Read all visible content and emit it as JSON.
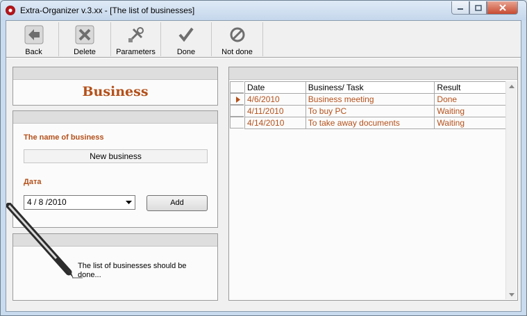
{
  "window": {
    "title": "Extra-Organizer v.3.xx  - [The list of businesses]"
  },
  "toolbar": {
    "buttons": [
      {
        "label": "Back",
        "icon": "back-arrow-icon"
      },
      {
        "label": "Delete",
        "icon": "delete-x-icon"
      },
      {
        "label": "Parameters",
        "icon": "tools-icon"
      },
      {
        "label": "Done",
        "icon": "checkmark-icon"
      },
      {
        "label": "Not done",
        "icon": "not-done-circle-icon"
      }
    ]
  },
  "form": {
    "heading": "Business",
    "name_label": "The name of business",
    "name_value": "New business",
    "date_label": "Дата",
    "date_value": "4 / 8 /2010",
    "add_label": "Add"
  },
  "note": {
    "text": "The list of businesses should be done..."
  },
  "grid": {
    "columns": [
      "Date",
      "Business/ Task",
      "Result"
    ],
    "rows": [
      {
        "date": "4/6/2010",
        "task": "Business meeting",
        "result": "Done"
      },
      {
        "date": "4/11/2010",
        "task": "To buy PC",
        "result": "Waiting"
      },
      {
        "date": "4/14/2010",
        "task": "To take away documents",
        "result": "Waiting"
      }
    ]
  },
  "colors": {
    "accent": "#b4501a",
    "panel_header": "#dedede"
  }
}
